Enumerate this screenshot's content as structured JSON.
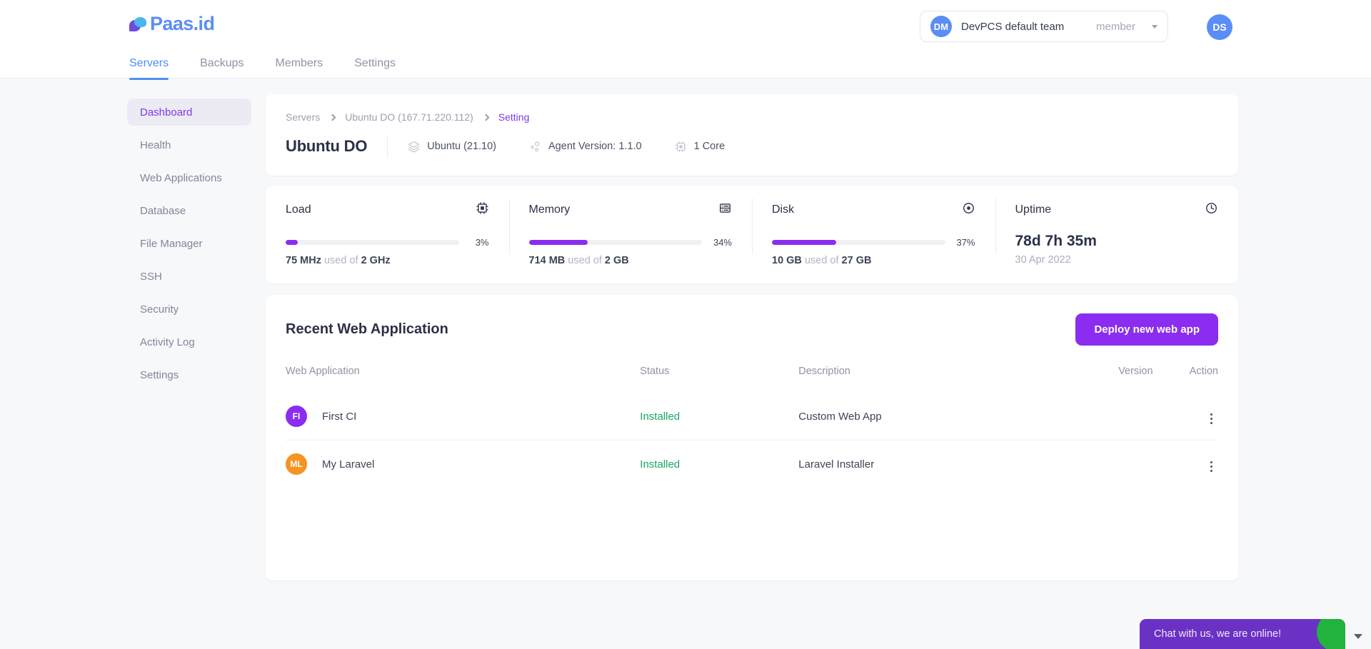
{
  "brand": {
    "name": "Paas.id"
  },
  "topnav": {
    "tabs": [
      {
        "label": "Servers",
        "active": true
      },
      {
        "label": "Backups",
        "active": false
      },
      {
        "label": "Members",
        "active": false
      },
      {
        "label": "Settings",
        "active": false
      }
    ],
    "team": {
      "initials": "DM",
      "name": "DevPCS default team",
      "role": "member"
    },
    "user": {
      "initials": "DS"
    }
  },
  "sidebar": {
    "items": [
      {
        "label": "Dashboard",
        "active": true
      },
      {
        "label": "Health",
        "active": false
      },
      {
        "label": "Web Applications",
        "active": false
      },
      {
        "label": "Database",
        "active": false
      },
      {
        "label": "File Manager",
        "active": false
      },
      {
        "label": "SSH",
        "active": false
      },
      {
        "label": "Security",
        "active": false
      },
      {
        "label": "Activity Log",
        "active": false
      },
      {
        "label": "Settings",
        "active": false
      }
    ]
  },
  "breadcrumb": [
    {
      "label": "Servers",
      "current": false
    },
    {
      "label": "Ubuntu DO (167.71.220.112)",
      "current": false
    },
    {
      "label": "Setting",
      "current": true
    }
  ],
  "server": {
    "title": "Ubuntu DO",
    "meta": [
      {
        "icon": "layers-icon",
        "label": "Ubuntu (21.10)"
      },
      {
        "icon": "nodes-icon",
        "label": "Agent Version: 1.1.0"
      },
      {
        "icon": "cpu-icon",
        "label": "1 Core"
      }
    ]
  },
  "metrics": [
    {
      "label": "Load",
      "icon": "cpu-chip-icon",
      "percent": 3,
      "percent_label": "3%",
      "used": "75 MHz",
      "middle": " used of ",
      "total": "2 GHz"
    },
    {
      "label": "Memory",
      "icon": "memory-icon",
      "percent": 34,
      "percent_label": "34%",
      "used": "714 MB",
      "middle": " used of ",
      "total": "2 GB"
    },
    {
      "label": "Disk",
      "icon": "disk-icon",
      "percent": 37,
      "percent_label": "37%",
      "used": "10 GB",
      "middle": " used of ",
      "total": "27 GB"
    }
  ],
  "uptime": {
    "label": "Uptime",
    "icon": "clock-icon",
    "value": "78d 7h 35m",
    "date": "30 Apr 2022"
  },
  "recent_apps": {
    "title": "Recent Web Application",
    "deploy_label": "Deploy new web app",
    "columns": {
      "app": "Web Application",
      "status": "Status",
      "description": "Description",
      "version": "Version",
      "action": "Action"
    },
    "rows": [
      {
        "initials": "FI",
        "color": "#8b2df0",
        "name": "First CI",
        "status": "Installed",
        "description": "Custom Web App",
        "version": ""
      },
      {
        "initials": "ML",
        "color": "#f59422",
        "name": "My Laravel",
        "status": "Installed",
        "description": "Laravel Installer",
        "version": ""
      }
    ]
  },
  "chat": {
    "text": "Chat with us, we are online!"
  },
  "colors": {
    "accent_purple": "#8b2df0",
    "brand_blue": "#5b8df6",
    "status_green": "#18a663",
    "chat_purple": "#6b30c4"
  }
}
